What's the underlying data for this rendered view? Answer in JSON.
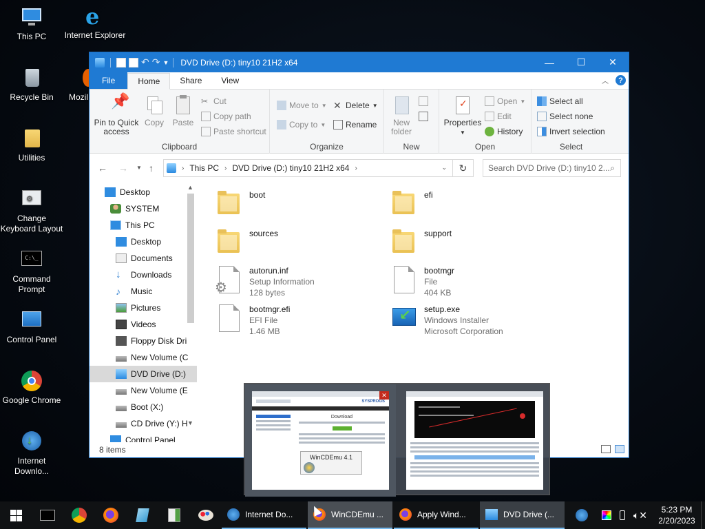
{
  "desktop": {
    "icons": [
      {
        "label": "This PC"
      },
      {
        "label": "Internet Explorer"
      },
      {
        "label": "Recycle Bin"
      },
      {
        "label": "Mozil"
      },
      {
        "label": "Utilities"
      },
      {
        "label": "Change Keyboard Layout"
      },
      {
        "label": "Command Prompt"
      },
      {
        "label": "Control Panel"
      },
      {
        "label": "Google Chrome"
      },
      {
        "label": "Internet Downlo..."
      }
    ]
  },
  "window": {
    "title": "DVD Drive (D:) tiny10 21H2 x64",
    "controls": {
      "minimize": "—",
      "maximize": "☐",
      "close": "✕"
    }
  },
  "ribbon_tabs": {
    "file": "File",
    "home": "Home",
    "share": "Share",
    "view": "View"
  },
  "ribbon": {
    "clipboard": {
      "pin": "Pin to Quick access",
      "copy": "Copy",
      "paste": "Paste",
      "cut": "Cut",
      "copy_path": "Copy path",
      "paste_shortcut": "Paste shortcut",
      "label": "Clipboard"
    },
    "organize": {
      "move_to": "Move to",
      "copy_to": "Copy to",
      "delete": "Delete",
      "rename": "Rename",
      "label": "Organize"
    },
    "new": {
      "new_folder": "New folder",
      "label": "New"
    },
    "open": {
      "properties": "Properties",
      "open": "Open",
      "edit": "Edit",
      "history": "History",
      "label": "Open"
    },
    "select": {
      "select_all": "Select all",
      "select_none": "Select none",
      "invert": "Invert selection",
      "label": "Select"
    }
  },
  "address": {
    "crumbs": [
      "This PC",
      "DVD Drive (D:) tiny10 21H2 x64"
    ],
    "search_placeholder": "Search DVD Drive (D:) tiny10 2..."
  },
  "nav": {
    "items": [
      {
        "label": "Desktop"
      },
      {
        "label": "SYSTEM"
      },
      {
        "label": "This PC"
      },
      {
        "label": "Desktop"
      },
      {
        "label": "Documents"
      },
      {
        "label": "Downloads"
      },
      {
        "label": "Music"
      },
      {
        "label": "Pictures"
      },
      {
        "label": "Videos"
      },
      {
        "label": "Floppy Disk Dri"
      },
      {
        "label": "New Volume (C"
      },
      {
        "label": "DVD Drive (D:)"
      },
      {
        "label": "New Volume (E"
      },
      {
        "label": "Boot (X:)"
      },
      {
        "label": "CD Drive (Y:) H"
      },
      {
        "label": "Control Panel"
      }
    ]
  },
  "files": [
    {
      "name": "boot",
      "type": "",
      "detail": ""
    },
    {
      "name": "efi",
      "type": "",
      "detail": ""
    },
    {
      "name": "sources",
      "type": "",
      "detail": ""
    },
    {
      "name": "support",
      "type": "",
      "detail": ""
    },
    {
      "name": "autorun.inf",
      "type": "Setup Information",
      "detail": "128 bytes"
    },
    {
      "name": "bootmgr",
      "type": "File",
      "detail": "404 KB"
    },
    {
      "name": "bootmgr.efi",
      "type": "EFI File",
      "detail": "1.46 MB"
    },
    {
      "name": "setup.exe",
      "type": "Windows Installer",
      "detail": "Microsoft Corporation"
    }
  ],
  "status": {
    "count": "8 items"
  },
  "thumbnails": {
    "left": {
      "heading": "SYSPROGS",
      "subtitle": "Download",
      "caption": "WinCDEmu 4.1"
    },
    "close": "✕"
  },
  "taskbar": {
    "tasks": [
      {
        "label": "Internet Do..."
      },
      {
        "label": "WinCDEmu ..."
      },
      {
        "label": "Apply Wind..."
      },
      {
        "label": "DVD Drive (..."
      }
    ],
    "clock": {
      "time": "5:23 PM",
      "date": "2/20/2023"
    }
  },
  "colors": {
    "accent": "#1f7ad3",
    "taskbar": "#101214",
    "desktop": "#060b12"
  }
}
